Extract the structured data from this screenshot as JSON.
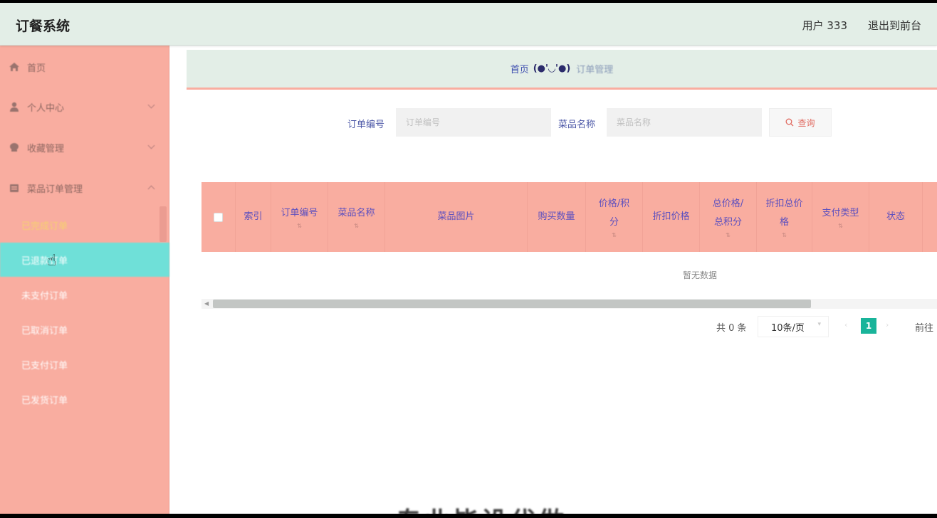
{
  "header": {
    "title": "订餐系统",
    "user_label": "用户 333",
    "exit_label": "退出到前台"
  },
  "sidebar": {
    "items": [
      {
        "label": "首页",
        "icon": "home-icon"
      },
      {
        "label": "个人中心",
        "icon": "user-icon"
      },
      {
        "label": "收藏管理",
        "icon": "star-icon"
      },
      {
        "label": "菜品订单管理",
        "icon": "order-icon"
      }
    ],
    "sub_items": [
      {
        "label": "已完成订单"
      },
      {
        "label": "已退款订单"
      },
      {
        "label": "未支付订单"
      },
      {
        "label": "已取消订单"
      },
      {
        "label": "已支付订单"
      },
      {
        "label": "已发货订单"
      }
    ]
  },
  "breadcrumb": {
    "home": "首页",
    "separator": "(●'◡'●)",
    "current": "订单管理"
  },
  "search": {
    "order_no_label": "订单编号",
    "order_no_placeholder": "订单编号",
    "dish_label": "菜品名称",
    "dish_placeholder": "菜品名称",
    "query_button": "查询"
  },
  "table": {
    "columns": [
      "索引",
      "订单编号",
      "菜品名称",
      "菜品图片",
      "购买数量",
      "价格/积分",
      "折扣价格",
      "总价格/总积分",
      "折扣总价格",
      "支付类型",
      "状态"
    ],
    "empty_text": "暂无数据"
  },
  "pagination": {
    "total": "共 0 条",
    "page_size": "10条/页",
    "current_page": "1",
    "goto": "前往"
  },
  "watermark": "专业毕设代做",
  "colors": {
    "header_bg": "#e3eee7",
    "sidebar_bg": "#f9ada0",
    "active_item": "#6fe0d8",
    "page_active": "#19b49a"
  }
}
